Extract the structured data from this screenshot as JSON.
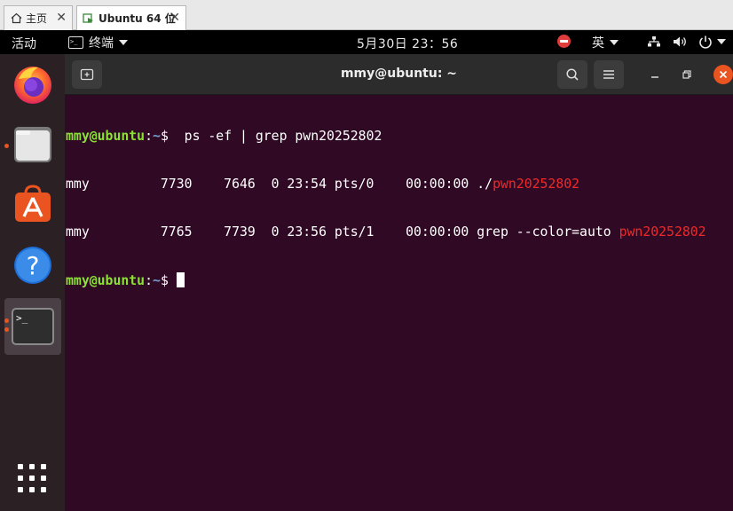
{
  "vm_tabs": {
    "home_label": "主页",
    "vm_label": "Ubuntu 64 位",
    "close_glyph": "✕"
  },
  "topbar": {
    "activities": "活动",
    "app_name": "终端",
    "clock": "5月30日 23：56",
    "input_method": "英"
  },
  "dock": {
    "items": [
      "firefox-icon",
      "files-icon",
      "software-center-icon",
      "help-icon",
      "terminal-icon"
    ],
    "accent": "#e95420"
  },
  "terminal": {
    "title": "mmy@ubuntu: ~",
    "background": "#300a24",
    "prompt_user": "mmy@ubuntu",
    "prompt_sep": ":",
    "prompt_path": "~",
    "prompt_sign": "$",
    "command": "  ps -ef | grep pwn20252802",
    "rows": [
      {
        "prefix": "mmy         7730    7646  0 23:54 pts/0    00:00:00 ./",
        "match": "pwn20252802"
      },
      {
        "prefix": "mmy         7765    7739  0 23:56 pts/1    00:00:00 grep --color=auto ",
        "match": "pwn20252802"
      }
    ]
  }
}
